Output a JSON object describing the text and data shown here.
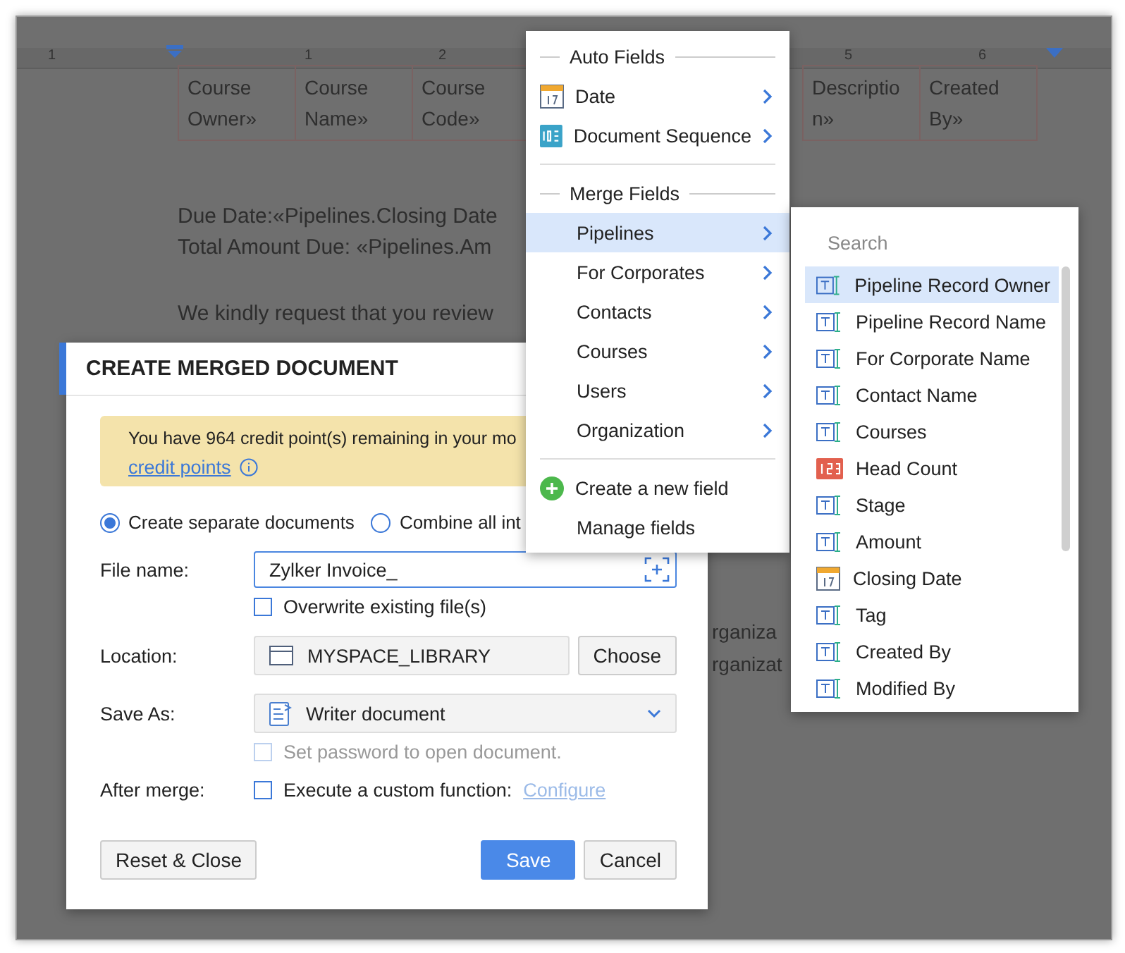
{
  "document": {
    "ruler": [
      "1",
      "1",
      "2",
      "5",
      "6"
    ],
    "table_left": [
      "Course Owner»",
      "Course Name»",
      "Course Code»"
    ],
    "table_right": [
      "Description»",
      "Created By»"
    ],
    "lines": [
      "Due Date:«Pipelines.Closing Date",
      "Total Amount Due: «Pipelines.Am",
      "We kindly request that you review"
    ],
    "fragments": [
      "rganiza",
      "rganizat"
    ]
  },
  "dialog": {
    "title": "CREATE MERGED DOCUMENT",
    "banner": {
      "text": "You have 964 credit point(s) remaining in your mo",
      "link": "credit points"
    },
    "radios": [
      {
        "label": "Create separate documents",
        "selected": true
      },
      {
        "label": "Combine all int",
        "selected": false
      }
    ],
    "file_name": {
      "label": "File name:",
      "value": "Zylker Invoice_"
    },
    "overwrite": {
      "label": "Overwrite existing file(s)",
      "checked": false
    },
    "location": {
      "label": "Location:",
      "value": "MYSPACE_LIBRARY",
      "button": "Choose"
    },
    "save_as": {
      "label": "Save As:",
      "value": "Writer document"
    },
    "password": {
      "label": "Set password to open document.",
      "checked": false,
      "disabled": true
    },
    "after_merge": {
      "label": "After merge:",
      "option": "Execute a custom function:",
      "checked": false,
      "link": "Configure",
      "link_disabled": true
    },
    "buttons_left": [
      {
        "label": "Reset & Close",
        "kind": "secondary"
      }
    ],
    "buttons_right": [
      {
        "label": "Save",
        "kind": "primary"
      },
      {
        "label": "Cancel",
        "kind": "secondary"
      }
    ]
  },
  "menu": {
    "sections": [
      {
        "title": "Auto Fields",
        "items": [
          {
            "label": "Date",
            "kind": "date",
            "selected": false
          },
          {
            "label": "Document Sequence",
            "kind": "sequence",
            "selected": false
          }
        ]
      },
      {
        "title": "Merge Fields",
        "items": [
          {
            "label": "Pipelines",
            "kind": "plain",
            "selected": true
          },
          {
            "label": "For Corporates",
            "kind": "plain",
            "selected": false
          },
          {
            "label": "Contacts",
            "kind": "plain",
            "selected": false
          },
          {
            "label": "Courses",
            "kind": "plain",
            "selected": false
          },
          {
            "label": "Users",
            "kind": "plain",
            "selected": false
          },
          {
            "label": "Organization",
            "kind": "plain",
            "selected": false
          }
        ]
      }
    ],
    "actions": [
      {
        "label": "Create a new field",
        "kind": "create"
      },
      {
        "label": "Manage fields",
        "kind": "plain"
      }
    ]
  },
  "submenu": {
    "search": {
      "placeholder": "Search"
    },
    "items": [
      {
        "label": "Pipeline Record Owner",
        "kind": "text",
        "selected": true
      },
      {
        "label": "Pipeline Record Name",
        "kind": "text",
        "selected": false
      },
      {
        "label": "For Corporate Name",
        "kind": "text",
        "selected": false
      },
      {
        "label": "Contact Name",
        "kind": "text",
        "selected": false
      },
      {
        "label": "Courses",
        "kind": "text",
        "selected": false
      },
      {
        "label": "Head Count",
        "kind": "number",
        "selected": false
      },
      {
        "label": "Stage",
        "kind": "text",
        "selected": false
      },
      {
        "label": "Amount",
        "kind": "text",
        "selected": false
      },
      {
        "label": "Closing Date",
        "kind": "date",
        "selected": false
      },
      {
        "label": "Tag",
        "kind": "text",
        "selected": false
      },
      {
        "label": "Created By",
        "kind": "text",
        "selected": false
      },
      {
        "label": "Modified By",
        "kind": "text",
        "selected": false
      }
    ]
  }
}
